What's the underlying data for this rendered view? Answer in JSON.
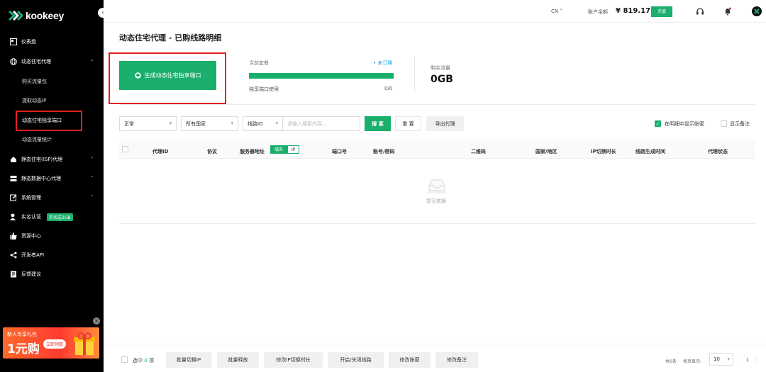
{
  "sidebar": {
    "logo_text": "kookeey",
    "items": [
      {
        "label": "仪表盘"
      },
      {
        "label": "动态住宅代理"
      },
      {
        "label": "静态住宅(ISP)代理"
      },
      {
        "label": "静态数据中心代理"
      },
      {
        "label": "系统管理"
      },
      {
        "label": "实名认证"
      },
      {
        "label": "资源中心"
      },
      {
        "label": "开发者API"
      },
      {
        "label": "反馈建议"
      }
    ],
    "sub_items": [
      {
        "label": "购买流量包"
      },
      {
        "label": "提取动态IP"
      },
      {
        "label": "动态住宅独享端口"
      },
      {
        "label": "动态流量统计"
      }
    ],
    "verify_badge": "实名送2GB",
    "promo": {
      "title": "新人专享礼包",
      "price": "1元购",
      "button": "立即领取"
    }
  },
  "header": {
    "language": "CN",
    "balance_label": "账户余额",
    "balance": "¥ 819.17",
    "recharge": "充值"
  },
  "main": {
    "title": "动态住宅代理 - 已购线路明细",
    "generate_button": "生成动态住宅独享端口",
    "plan_label": "当前套餐",
    "plan_link": "• 未订购",
    "plan_usage_fraction": 1.0,
    "port_usage_label": "独享端口使用",
    "port_usage_value": "0/0",
    "remaining_label": "剩余流量",
    "remaining_value": "0GB"
  },
  "filters": {
    "status": "正常",
    "country": "所有国家",
    "route_type": "线路ID",
    "search_placeholder": "请输入搜索内容...",
    "search_button": "搜 索",
    "reset_button": "重 置",
    "export_button": "导出代理",
    "show_account_label": "在明细中显示账密",
    "show_account_checked": true,
    "show_note_label": "显示备注",
    "show_note_checked": false
  },
  "table": {
    "columns": [
      "代理ID",
      "协议",
      "服务器地址",
      "端口号",
      "账号/密码",
      "二维码",
      "国家/地区",
      "IP切换时长",
      "线路生成时间",
      "代理状态"
    ],
    "server_toggle": [
      "域名",
      "IP"
    ],
    "empty_text": "暂无数据"
  },
  "footer": {
    "selected_prefix": "选中",
    "selected_count": "0",
    "selected_suffix": "项",
    "buttons": [
      "批量切换IP",
      "批量释放",
      "修改IP切换时长",
      "开启/关闭线路",
      "修改账密",
      "修改备注"
    ],
    "total": "共0条",
    "per_page_label": "每页显示:",
    "per_page": "10",
    "page": "1"
  }
}
